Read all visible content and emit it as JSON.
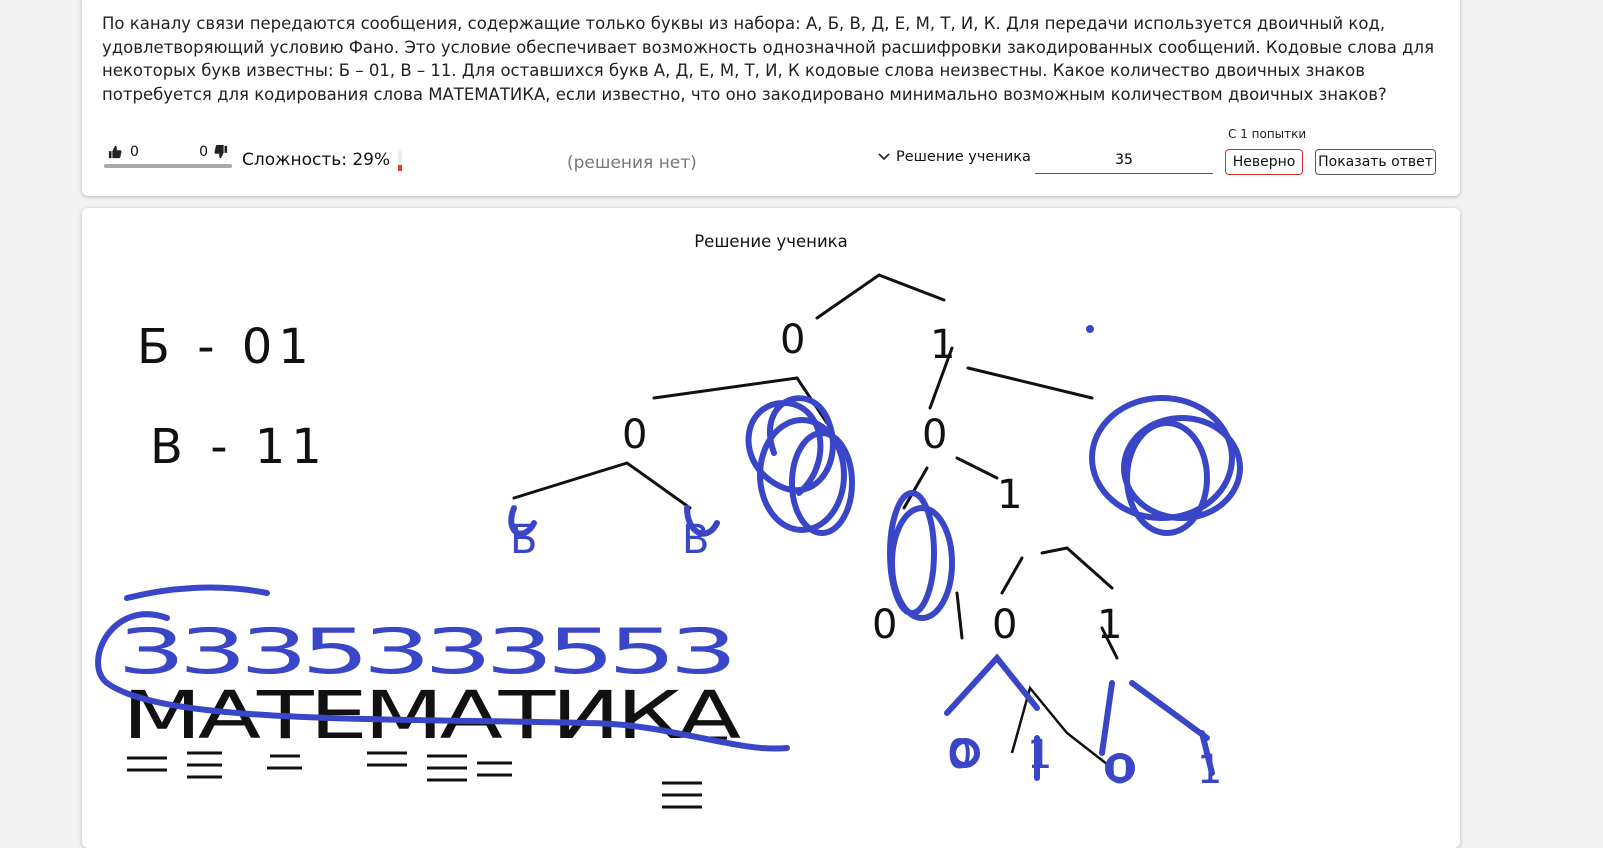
{
  "task": {
    "text": "По каналу связи передаются сообщения, содержащие только буквы из набора: А, Б, В, Д, Е, М, Т, И, К. Для передачи используется двоичный код, удовлетворяющий условию Фано. Это условие обеспечивает возможность однозначной расшифровки закодированных сообщений. Кодовые слова для некоторых букв известны: Б – 01, В – 11. Для оставшихся букв А, Д, Е, М, Т, И, К кодовые слова неизвестны. Какое количество двоичных знаков потребуется для кодирования слова МАТЕМАТИКА, если известно, что оно закодировано минимально возможным количеством двоичных знаков?"
  },
  "votes": {
    "likes": "0",
    "dislikes": "0"
  },
  "difficulty": {
    "label": "Сложность: 29%",
    "percent": 29,
    "color": "#e53935"
  },
  "no_solutions": "(решения нет)",
  "student_solution_toggle": "Решение ученика",
  "answer": {
    "value": "35"
  },
  "attempts": "С 1 попытки",
  "buttons": {
    "wrong": "Неверно",
    "show_answer": "Показать ответ"
  },
  "solution": {
    "title": "Решение ученика",
    "known_codes": [
      "Б - 01",
      "В - 11"
    ],
    "word": "МАТЕМАТИКА",
    "digits": "3 3 3 5 3 3 3 5 5 3",
    "tree_labels": [
      "0",
      "1",
      "0",
      "1",
      "0",
      "1",
      "Б",
      "В",
      "0",
      "1",
      "0",
      "1",
      "0",
      "1",
      "0",
      "1"
    ],
    "colors": {
      "ink": "#111111",
      "marker": "#3a46c8"
    }
  }
}
